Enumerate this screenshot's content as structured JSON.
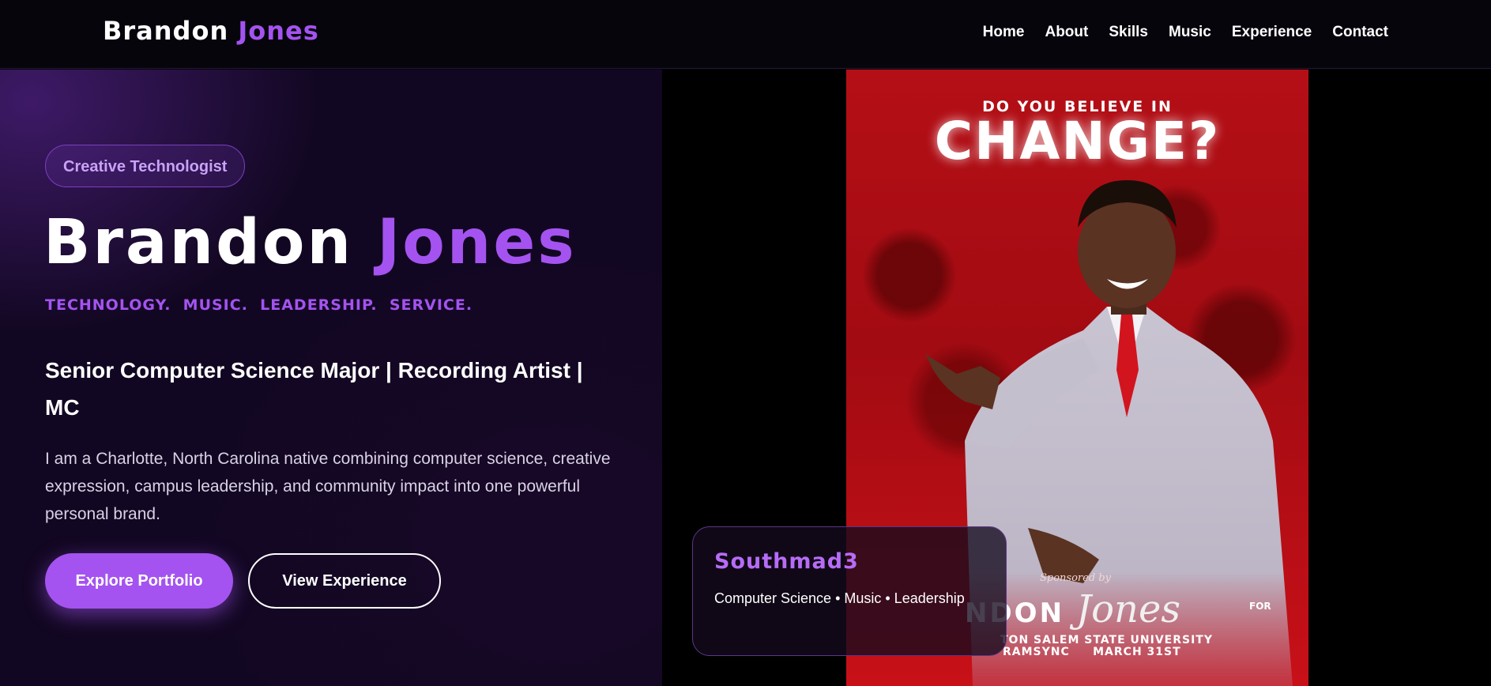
{
  "nav": {
    "logo_first": "Brandon",
    "logo_last": "Jones",
    "links": [
      "Home",
      "About",
      "Skills",
      "Music",
      "Experience",
      "Contact"
    ]
  },
  "hero": {
    "badge": "Creative Technologist",
    "name_first": "Brandon",
    "name_last": "Jones",
    "tagline": "TECHNOLOGY.  MUSIC.  LEADERSHIP.  SERVICE.",
    "subtitle": "Senior Computer Science Major | Recording Artist | MC",
    "description": "I am a Charlotte, North Carolina native combining computer science, creative expression, campus leadership, and community impact into one powerful personal brand.",
    "primary_button": "Explore Portfolio",
    "secondary_button": "View Experience"
  },
  "poster": {
    "pre_title": "DO YOU BELIEVE IN",
    "title": "CHANGE?",
    "sponsor": "Sponsored by",
    "brand_bold": "NDON",
    "brand_script": "Jones",
    "for_label": "FOR",
    "university": "TON SALEM STATE UNIVERSITY",
    "date_line": "RAMSYNC     MARCH 31ST"
  },
  "card": {
    "title": "Southmad3",
    "subtitle": "Computer Science • Music • Leadership"
  },
  "colors": {
    "accent": "#a453f0",
    "background": "#120722",
    "poster_red": "#b50f16"
  }
}
